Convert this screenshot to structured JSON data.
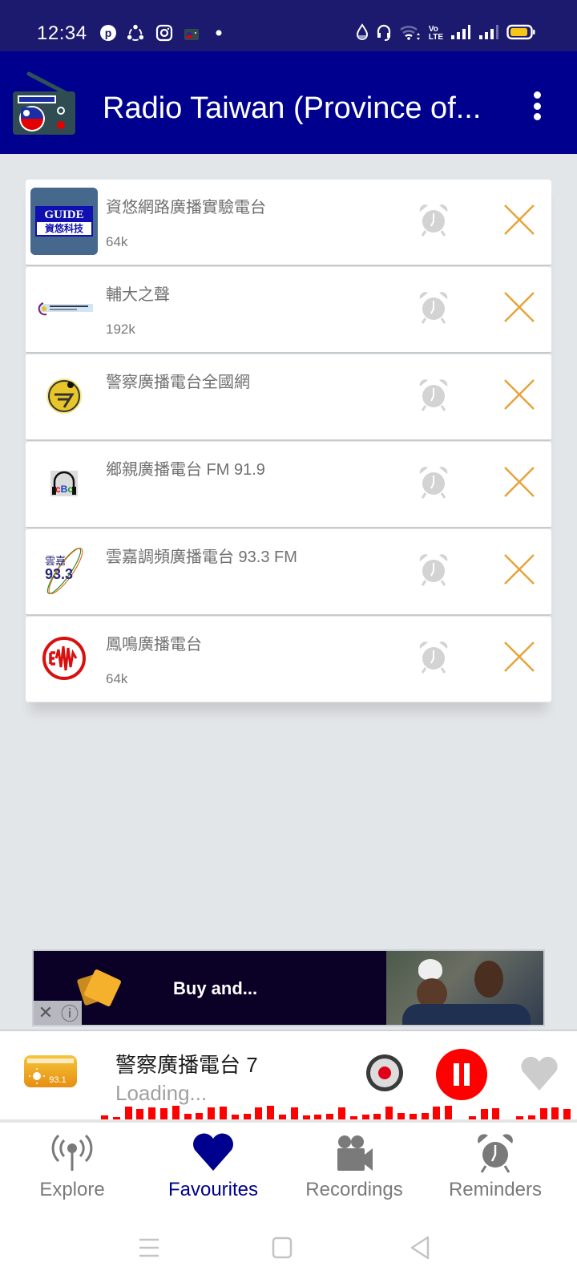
{
  "status_bar": {
    "time": "12:34",
    "left_icons": [
      "pinterest-icon",
      "share-icon",
      "instagram-icon",
      "radio-app-icon",
      "dot-icon"
    ],
    "right_icons": [
      "water-drop-icon",
      "headset-icon",
      "wifi-icon",
      "volte-icon",
      "signal-icon",
      "signal-icon",
      "battery-icon"
    ],
    "volte_label_top": "Vo",
    "volte_label_bottom": "LTE",
    "battery_color": "#f5c518"
  },
  "app_bar": {
    "title": "Radio Taiwan (Province of...",
    "menu_icon": "more-vert-icon",
    "background": "#00008f"
  },
  "favourites": [
    {
      "name": "資悠網路廣播實驗電台",
      "bitrate": "64k",
      "logo": "guide-logo",
      "logo_text_top": "GUIDE",
      "logo_text_bottom": "資悠科技"
    },
    {
      "name": "輔大之聲",
      "bitrate": "192k",
      "logo": "fju-logo"
    },
    {
      "name": "警察廣播電台全國網",
      "bitrate": "",
      "logo": "police-logo"
    },
    {
      "name": "鄉親廣播電台 FM 91.9",
      "bitrate": "",
      "logo": "cbc-logo",
      "logo_text": "cBc"
    },
    {
      "name": "雲嘉調頻廣播電台 93.3 FM",
      "bitrate": "",
      "logo": "yunjia-logo",
      "logo_text_top": "雲嘉",
      "logo_text_bottom": "93.3"
    },
    {
      "name": "鳳鳴廣播電台",
      "bitrate": "64k",
      "logo": "fengming-logo"
    }
  ],
  "row_actions": {
    "alarm_icon": "alarm-clock-icon",
    "remove_icon": "close-icon",
    "remove_color": "#e8a33a",
    "alarm_color": "#d3d3d3"
  },
  "ad": {
    "text": "Buy and...",
    "close_label": "✕",
    "info_label": "ⓘ"
  },
  "player": {
    "title": "警察廣播電台 7",
    "status": "Loading...",
    "logo_text": "93.1",
    "record_icon": "record-icon",
    "pause_icon": "pause-icon",
    "favourite_icon": "heart-icon",
    "visualizer_levels": [
      0.3,
      0.15,
      0.9,
      0.75,
      0.85,
      0.8,
      0.95,
      0.4,
      0.45,
      0.85,
      0.9,
      0.35,
      0.4,
      0.85,
      0.95,
      0.35,
      0.85,
      0.3,
      0.35,
      0.4,
      0.85,
      0.2,
      0.35,
      0.4,
      0.9,
      0.45,
      0.4,
      0.45,
      0.9,
      0.95,
      0,
      0.2,
      0.75,
      0.8,
      0,
      0.25,
      0.3,
      0.8,
      0.85,
      0.75
    ]
  },
  "bottom_nav": [
    {
      "label": "Explore",
      "icon": "antenna-icon",
      "active": false
    },
    {
      "label": "Favourites",
      "icon": "heart-icon",
      "active": true
    },
    {
      "label": "Recordings",
      "icon": "video-camera-icon",
      "active": false
    },
    {
      "label": "Reminders",
      "icon": "alarm-clock-icon",
      "active": false
    }
  ],
  "system_nav": [
    "recents-icon",
    "home-icon",
    "back-icon"
  ]
}
